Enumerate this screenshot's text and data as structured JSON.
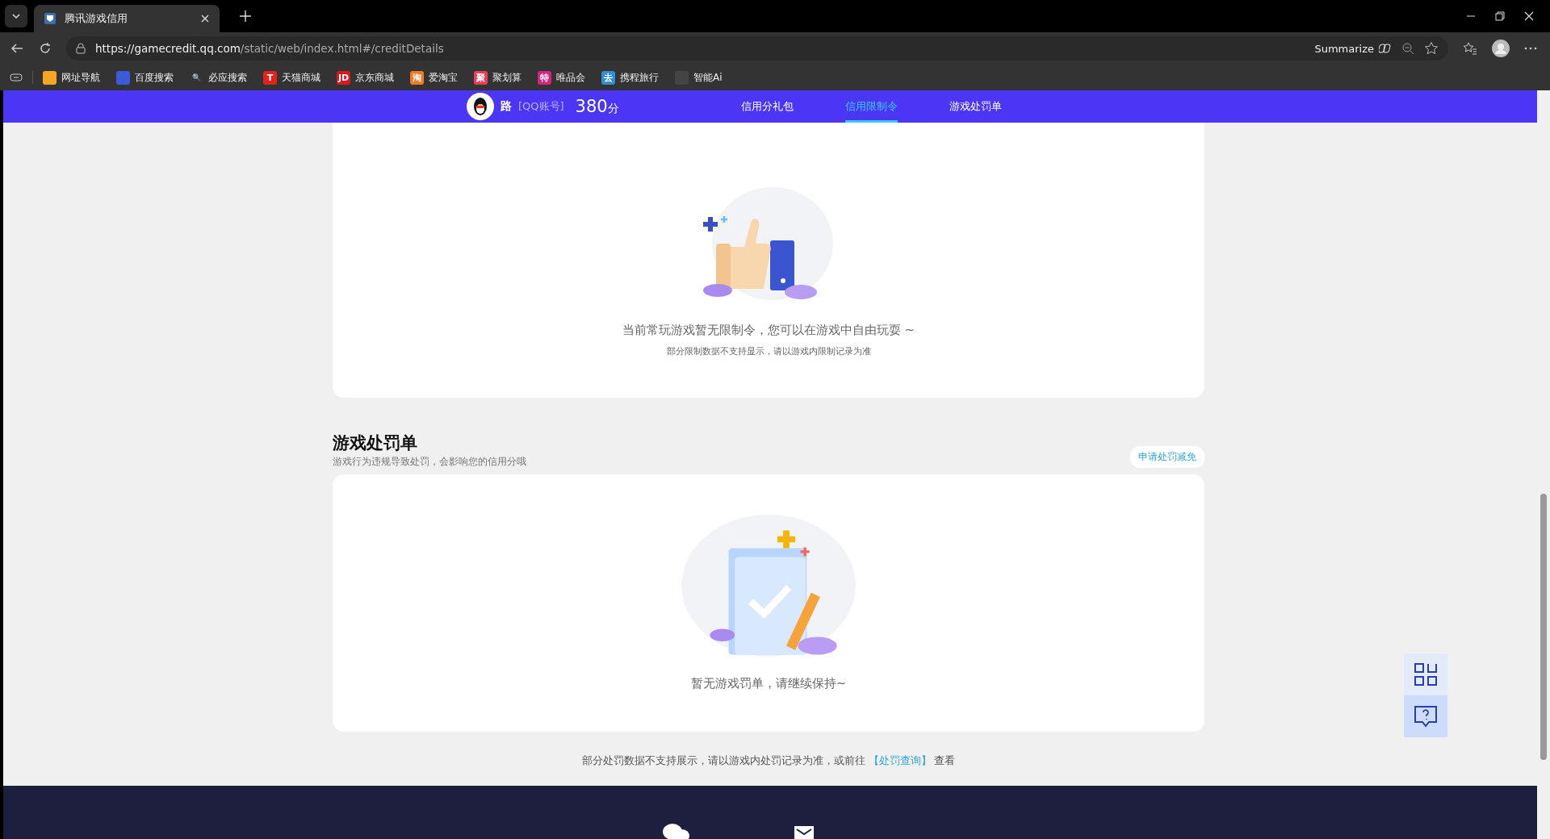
{
  "browser": {
    "tab_title": "腾讯游戏信用",
    "url_host": "https://gamecredit.qq.com",
    "url_path": "/static/web/index.html#/creditDetails",
    "summarize": "Summarize",
    "bookmarks": [
      {
        "label": "网址导航",
        "color": "#f5a623"
      },
      {
        "label": "百度搜索",
        "color": "#3b5bdb"
      },
      {
        "label": "必应搜索",
        "glyph": "🔍"
      },
      {
        "label": "天猫商城",
        "color": "#e2231a",
        "glyph": "T"
      },
      {
        "label": "京东商城",
        "color": "#d71920",
        "glyph": "JD"
      },
      {
        "label": "爱淘宝",
        "color": "#f07b22",
        "glyph": "淘"
      },
      {
        "label": "聚划算",
        "color": "#e83e5a",
        "glyph": "聚"
      },
      {
        "label": "唯品会",
        "color": "#d6247e",
        "glyph": "特"
      },
      {
        "label": "携程旅行",
        "color": "#2d8fd5",
        "glyph": "去"
      },
      {
        "label": "智能Ai",
        "color": "#444444"
      }
    ]
  },
  "header": {
    "user_name": "路",
    "account": "[QQ账号]",
    "score": "380",
    "score_unit": "分",
    "nav": [
      {
        "label": "信用分礼包",
        "selected": false
      },
      {
        "label": "信用限制令",
        "selected": true
      },
      {
        "label": "游戏处罚单",
        "selected": false
      }
    ]
  },
  "restriction_card": {
    "message": "当前常玩游戏暂无限制令，您可以在游戏中自由玩耍 ~",
    "note": "部分限制数据不支持显示，请以游戏内限制记录为准"
  },
  "penalty_section": {
    "title": "游戏处罚单",
    "subtitle": "游戏行为违规导致处罚，会影响您的信用分哦",
    "button": "申请处罚减免",
    "empty_message": "暂无游戏罚单，请继续保持~"
  },
  "footer_note": {
    "text": "部分处罚数据不支持展示，请以游戏内处罚记录为准，或前往",
    "link": "【处罚查询】",
    "after": "查看"
  }
}
